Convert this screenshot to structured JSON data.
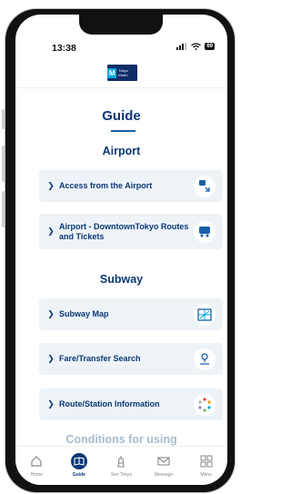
{
  "status": {
    "time": "13:38",
    "battery": "69"
  },
  "logo": {
    "mark": "M",
    "text": "Tokyo Metro"
  },
  "page": {
    "title": "Guide"
  },
  "sections": {
    "airport": "Airport",
    "subway": "Subway",
    "peek": "Conditions for using"
  },
  "cards": [
    {
      "label": "Access from the Airport",
      "icon": "airport-access-icon"
    },
    {
      "label": "Airport - DowntownTokyo Routes and Tickets",
      "icon": "bus-train-icon"
    },
    {
      "label": "Subway Map",
      "icon": "subway-map-icon"
    },
    {
      "label": "Fare/Transfer Search",
      "icon": "route-search-icon"
    },
    {
      "label": "Route/Station Information",
      "icon": "station-info-icon"
    }
  ],
  "tabs": [
    {
      "label": "Home",
      "icon": "home-icon"
    },
    {
      "label": "Guide",
      "icon": "book-icon"
    },
    {
      "label": "See Tokyo",
      "icon": "tower-icon"
    },
    {
      "label": "Message",
      "icon": "mail-icon"
    },
    {
      "label": "Menu",
      "icon": "grid-icon"
    }
  ],
  "colors": {
    "primary": "#0a3875",
    "card": "#eef3f8",
    "accent": "#00a7db"
  }
}
